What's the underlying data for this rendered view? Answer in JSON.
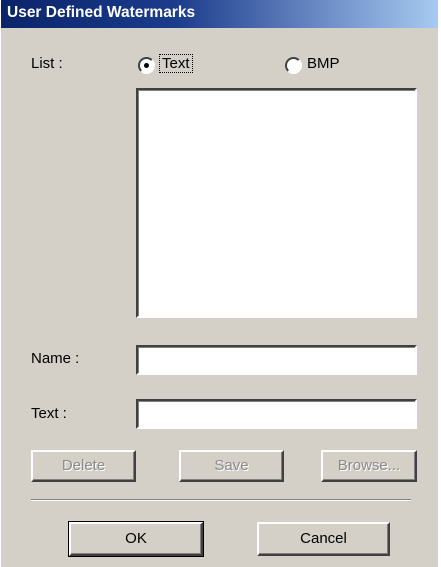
{
  "window": {
    "title": "User Defined Watermarks"
  },
  "list": {
    "label": "List :",
    "options": [
      {
        "label": "Text",
        "selected": true
      },
      {
        "label": "BMP",
        "selected": false
      }
    ],
    "items": []
  },
  "fields": {
    "name_label": "Name :",
    "name_value": "",
    "text_label": "Text :",
    "text_value": ""
  },
  "actions": {
    "delete_label": "Delete",
    "save_label": "Save",
    "browse_label": "Browse..."
  },
  "footer": {
    "ok_label": "OK",
    "cancel_label": "Cancel"
  },
  "colors": {
    "dialog_bg": "#d4d0c8",
    "title_bar": "#0a246a",
    "title_text": "#ffffff",
    "disabled_text": "#8a8a8a"
  }
}
